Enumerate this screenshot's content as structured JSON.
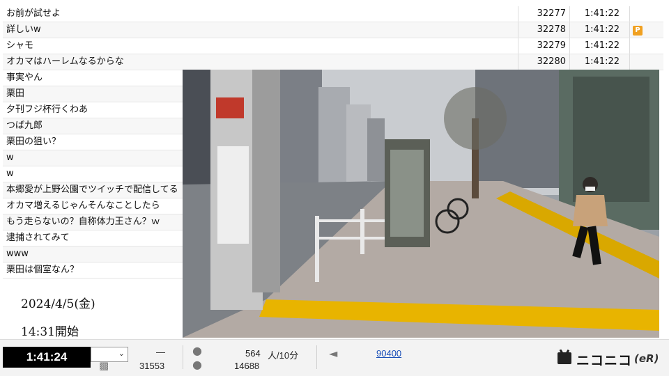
{
  "comments_top": [
    {
      "text": "お前が試せよ",
      "no": "32277",
      "time": "1:41:22",
      "flag": ""
    },
    {
      "text": "詳しいw",
      "no": "32278",
      "time": "1:41:22",
      "flag": "P"
    },
    {
      "text": "シャモ",
      "no": "32279",
      "time": "1:41:22",
      "flag": ""
    },
    {
      "text": "オカマはハーレムなるからな",
      "no": "32280",
      "time": "1:41:22",
      "flag": ""
    }
  ],
  "comments_left": [
    {
      "text": "事実やん"
    },
    {
      "text": "栗田"
    },
    {
      "text": "夕刊フジ杯行くわあ"
    },
    {
      "text": "つば九郎"
    },
    {
      "text": "栗田の狙い？"
    },
    {
      "text": "w"
    },
    {
      "text": "w"
    },
    {
      "text": "本郷愛が上野公園でツイッチで配信してる"
    },
    {
      "text": "オカマ増えるじゃんそんなことしたら"
    },
    {
      "text": "もう走らないの？自称体力王さん？ｗ"
    },
    {
      "text": "逮捕されてみて"
    },
    {
      "text": "www"
    },
    {
      "text": "栗田は個室なん？"
    }
  ],
  "date_text": "2024/4/5(金)",
  "start_text": "14:31開始",
  "status": {
    "elapsed": "1:41:24",
    "dash": "—",
    "comment_count": "31553",
    "viewers_per_10min": "564",
    "viewers_unit": "人/10分",
    "total_viewers": "14688",
    "ad_points": "90400"
  },
  "logo_text": "ニコニコ",
  "logo_suffix": "(eR)",
  "colors": {
    "accent_link": "#1a4fb8",
    "premium": "#f0a020",
    "tactile_paving": "#e8b400"
  },
  "icons": [
    "chat-icon",
    "users-icon",
    "person-icon",
    "megaphone-icon",
    "tv-icon"
  ]
}
